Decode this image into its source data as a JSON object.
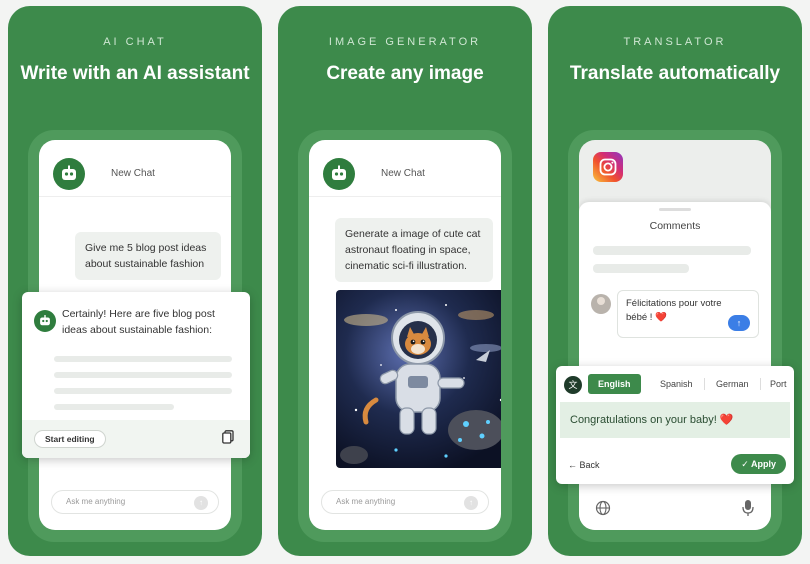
{
  "cards": [
    {
      "eyebrow": "AI CHAT",
      "headline": "Write with an AI assistant",
      "chat_title": "New Chat",
      "user_message": "Give me 5 blog post ideas about sustainable fashion",
      "ai_reply": "Certainly! Here are five blog post ideas about sustainable fashion:",
      "start_editing_label": "Start editing",
      "input_placeholder": "Ask me anything"
    },
    {
      "eyebrow": "IMAGE GENERATOR",
      "headline": "Create any image",
      "chat_title": "New Chat",
      "user_message": "Generate a image of cute cat astronaut floating in space, cinematic sci-fi illustration.",
      "input_placeholder": "Ask me anything"
    },
    {
      "eyebrow": "TRANSLATOR",
      "headline": "Translate automatically",
      "comments_title": "Comments",
      "comment_text": "Félicitations pour votre bébé ! ❤️",
      "languages": [
        "English",
        "Spanish",
        "German",
        "Port"
      ],
      "translation": "Congratulations on your baby! ❤️",
      "back_label": "Back",
      "apply_label": "Apply"
    }
  ],
  "colors": {
    "brand_green": "#3d8a4b",
    "halo_green": "#4f9a5c",
    "send_blue": "#3b7ee6"
  },
  "icons": [
    "robot-icon",
    "copy-icon",
    "send-icon",
    "instagram-icon",
    "translate-icon",
    "back-arrow-icon",
    "check-icon",
    "globe-icon",
    "microphone-icon"
  ]
}
